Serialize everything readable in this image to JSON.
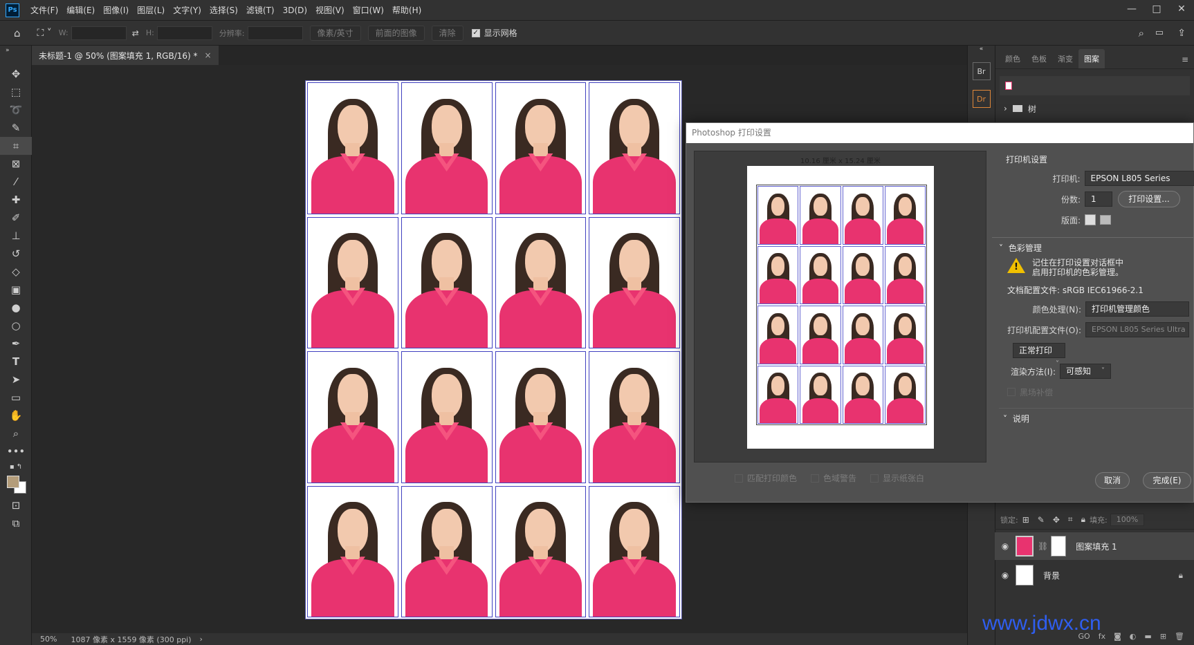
{
  "app": {
    "logo": "Ps"
  },
  "menu": [
    "文件(F)",
    "编辑(E)",
    "图像(I)",
    "图层(L)",
    "文字(Y)",
    "选择(S)",
    "滤镜(T)",
    "3D(D)",
    "视图(V)",
    "窗口(W)",
    "帮助(H)"
  ],
  "window_controls": {
    "minimize": "—",
    "restore": "□",
    "close": "✕"
  },
  "options_bar": {
    "w_label": "W:",
    "h_label": "H:",
    "resolution_label": "分辨率:",
    "unit_select": "像素/英寸",
    "front_image_button": "前面的图像",
    "clear_button": "清除",
    "show_grid_label": "显示网格"
  },
  "document": {
    "tab_title": "未标题-1 @ 50% (图案填充 1, RGB/16) *",
    "photo_rows": 4,
    "photo_cols": 4
  },
  "status": {
    "zoom": "50%",
    "doc_info": "1087 像素 x 1559 像素 (300 ppi)",
    "arrow": "›"
  },
  "right_panel": {
    "strip_icons": [
      "Br",
      "Dr"
    ],
    "tabs": [
      "颜色",
      "色板",
      "渐变",
      "图案"
    ],
    "active_tab": "图案",
    "folder_name": "树"
  },
  "layers": {
    "lock_label": "锁定:",
    "fill_label": "填充:",
    "fill_value": "100%",
    "items": [
      {
        "name": "图案填充 1",
        "selected": true
      },
      {
        "name": "背景",
        "selected": false
      }
    ],
    "bottom_icons": [
      "GO",
      "fx"
    ]
  },
  "print_dialog": {
    "title": "Photoshop 打印设置",
    "paper_label": "10.16 厘米 x 15.24 厘米",
    "printer_setup_title": "打印机设置",
    "printer_label": "打印机:",
    "printer_value": "EPSON L805 Series",
    "copies_label": "份数:",
    "copies_value": "1",
    "print_settings_button": "打印设置...",
    "layout_label": "版面:",
    "color_mgmt_title": "色彩管理",
    "warning_line1": "记住在打印设置对话框中",
    "warning_line2": "启用打印机的色彩管理。",
    "doc_profile": "文档配置文件: sRGB IEC61966-2.1",
    "color_handling_label": "颜色处理(N):",
    "color_handling_value": "打印机管理颜色",
    "printer_profile_label": "打印机配置文件(O):",
    "printer_profile_value": "EPSON L805 Series Ultra",
    "normal_print": "正常打印",
    "render_label": "渲染方法(I):",
    "render_value": "可感知",
    "black_point": "黑场补偿",
    "description_title": "说明",
    "check_match": "匹配打印颜色",
    "check_gamut": "色域警告",
    "check_paper": "显示纸张白",
    "cancel_button": "取消",
    "done_button": "完成(E)"
  },
  "watermark": "www.jdwx.cn",
  "colors": {
    "accent": "#31a8ff",
    "shirt": "#e8336f",
    "warning": "#f0c000",
    "watermark": "#2f5ef0"
  }
}
